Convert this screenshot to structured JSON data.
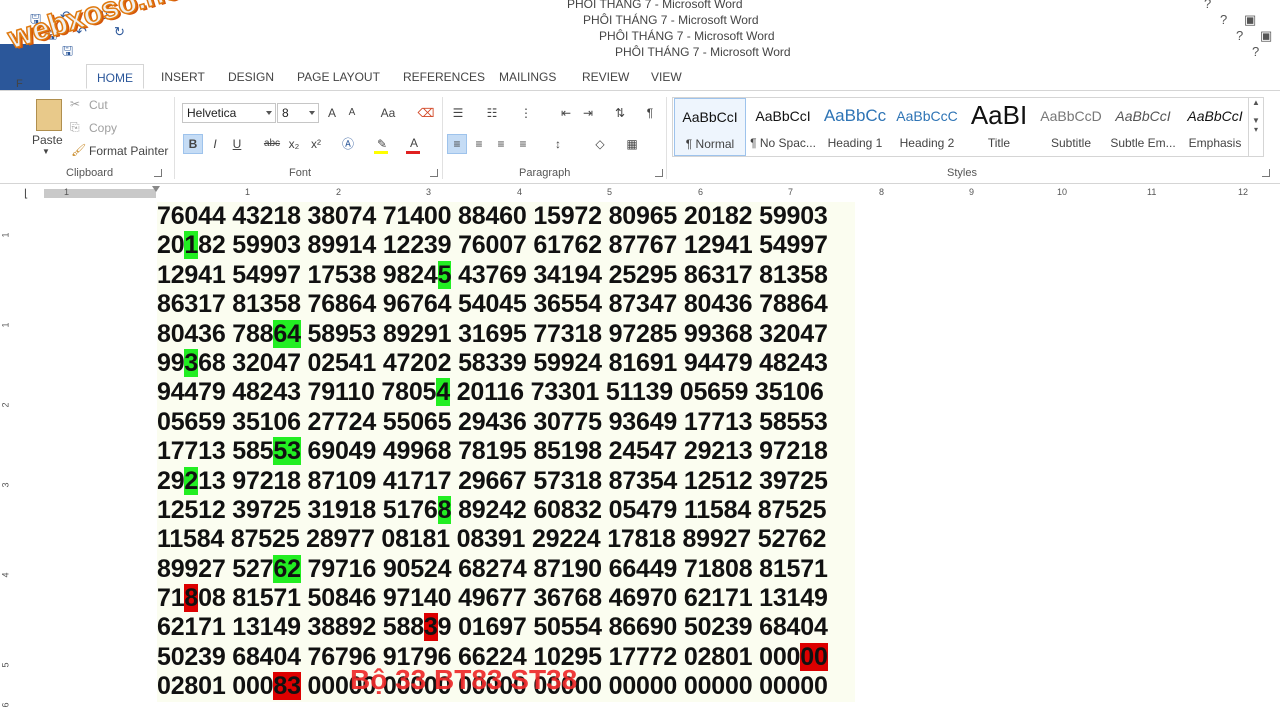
{
  "window": {
    "titles": [
      "PHÔI THÁNG 7 - Microsoft Word",
      "PHÔI THÁNG 7 - Microsoft Word",
      "PHÔI THÁNG 7 - Microsoft Word",
      "PHÔI THÁNG 7 - Microsoft Word"
    ],
    "help": "?",
    "close": "✕"
  },
  "logo": {
    "text": "webxoso.net"
  },
  "tabs": [
    "HOME",
    "INSERT",
    "DESIGN",
    "PAGE LAYOUT",
    "REFERENCES",
    "MAILINGS",
    "REVIEW",
    "VIEW"
  ],
  "clipboard": {
    "paste": "Paste",
    "cut": "Cut",
    "copy": "Copy",
    "format_painter": "Format Painter",
    "label": "Clipboard"
  },
  "font": {
    "name": "Helvetica",
    "size": "8",
    "label": "Font",
    "change_case": "Aa",
    "bold": "B",
    "italic": "I",
    "underline": "U",
    "strike": "abc",
    "sub": "x₂",
    "sup": "x²",
    "grow": "A",
    "shrink": "A"
  },
  "paragraph": {
    "label": "Paragraph"
  },
  "styles": {
    "label": "Styles",
    "items": [
      {
        "preview": "AaBbCcI",
        "name": "¶ Normal"
      },
      {
        "preview": "AaBbCcI",
        "name": "¶ No Spac..."
      },
      {
        "preview": "AaBbCc",
        "name": "Heading 1"
      },
      {
        "preview": "AaBbCcC",
        "name": "Heading 2"
      },
      {
        "preview": "AaBI",
        "name": "Title"
      },
      {
        "preview": "AaBbCcD",
        "name": "Subtitle"
      },
      {
        "preview": "AaBbCcI",
        "name": "Subtle Em..."
      },
      {
        "preview": "AaBbCcI",
        "name": "Emphasis"
      }
    ]
  },
  "ruler": {
    "h": [
      "1",
      "1",
      "2",
      "3",
      "4",
      "5",
      "6",
      "7",
      "8",
      "9",
      "10",
      "11",
      "12"
    ],
    "v": [
      "1",
      "1",
      "2",
      "3",
      "4",
      "5",
      "6"
    ]
  },
  "document": {
    "lines": [
      "76044 43218 38074 71400 88460 15972 80965 20182 59903",
      "20182 59903 89914 12239 76007 61762 87767 12941 54997",
      "12941 54997 17538 98245 43769 34194 25295 86317 81358",
      "86317 81358 76864 96764 54045 36554 87347 80436 78864",
      "80436 78864 58953 89291 31695 77318 97285 99368 32047",
      "99368 32047 02541 47202 58339 59924 81691 94479 48243",
      "94479 48243 79110 78054 20116 73301 51139 05659 35106",
      "05659 35106 27724 55065 29436 30775 93649 17713 58553",
      "17713 58553 69049 49968 78195 85198 24547 29213 97218",
      "29213 97218 87109 41717 29667 57318 87354 12512 39725",
      "12512 39725 31918 51768 89242 60832 05479 11584 87525",
      "11584 87525 28977 08181 08391 29224 17818 89927 52762",
      "89927 52762 79716 90524 68274 87190 66449 71808 81571",
      "71808 81571 50846 97140 49677 36768 46970 62171 13149",
      "62171 13149 38892 58839 01697 50554 86690 50239 68404",
      "50239 68404 76796 91796 66224 10295 17772 02801 00000",
      "02801 00083 00000 00000 00000 00000 00000 00000 00000"
    ],
    "highlights": [
      {
        "line": 1,
        "start": 2,
        "len": 1,
        "color": "green"
      },
      {
        "line": 2,
        "start": 22,
        "len": 1,
        "color": "green"
      },
      {
        "line": 4,
        "start": 9,
        "len": 2,
        "color": "green"
      },
      {
        "line": 5,
        "start": 2,
        "len": 1,
        "color": "green"
      },
      {
        "line": 6,
        "start": 22,
        "len": 1,
        "color": "green"
      },
      {
        "line": 8,
        "start": 9,
        "len": 2,
        "color": "green"
      },
      {
        "line": 9,
        "start": 2,
        "len": 1,
        "color": "green"
      },
      {
        "line": 10,
        "start": 22,
        "len": 1,
        "color": "green"
      },
      {
        "line": 12,
        "start": 9,
        "len": 2,
        "color": "green"
      },
      {
        "line": 13,
        "start": 2,
        "len": 1,
        "color": "red"
      },
      {
        "line": 14,
        "start": 21,
        "len": 1,
        "color": "red"
      },
      {
        "line": 15,
        "start": 51,
        "len": 2,
        "color": "red"
      },
      {
        "line": 16,
        "start": 9,
        "len": 2,
        "color": "red"
      }
    ],
    "overlay_text": "Bộ 33 BT83 ST38"
  },
  "colors": {
    "accent": "#2b579a",
    "green_hl": "#22ee22",
    "red_hl": "#dd0000",
    "overlay": "#ee2a2a"
  }
}
